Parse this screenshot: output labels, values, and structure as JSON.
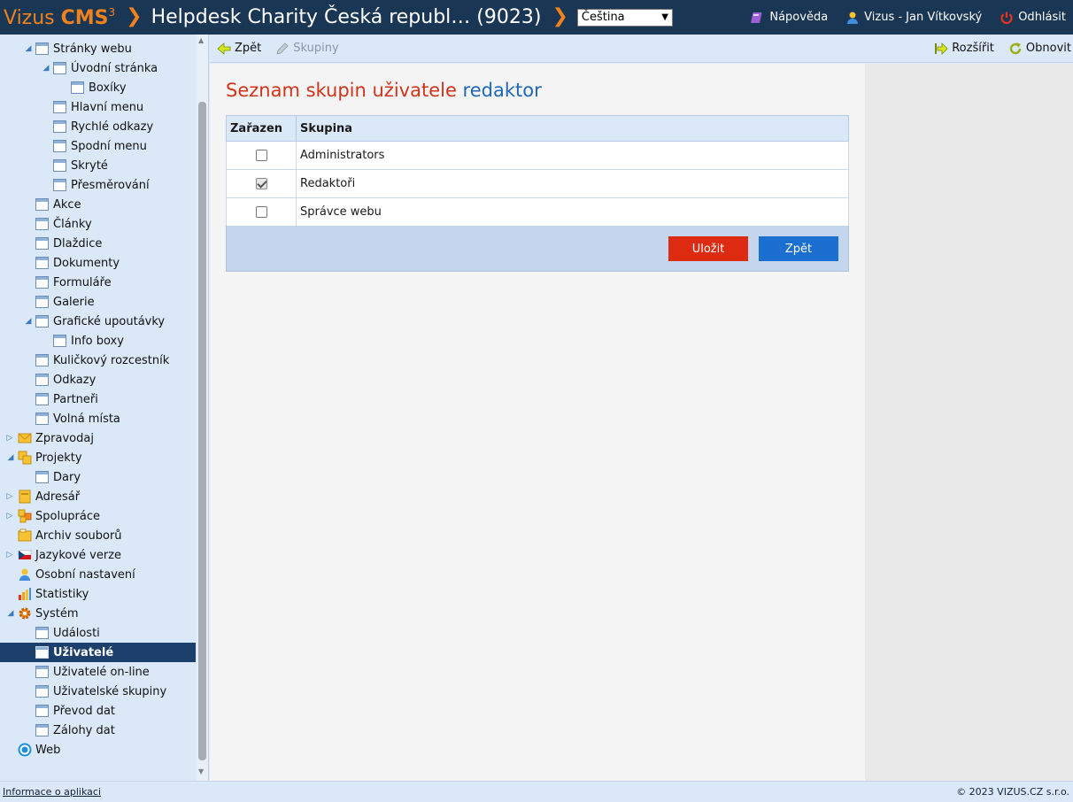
{
  "header": {
    "brand_light": "Vizus ",
    "brand_bold": "CMS",
    "brand_sup": "3",
    "site_title": "Helpdesk Charity Česká republ… (9023)",
    "language": "Čeština",
    "help_label": "Nápověda",
    "user_label": "Vizus - Jan Vítkovský",
    "logout_label": "Odhlásit"
  },
  "toolbar": {
    "back_label": "Zpět",
    "groups_label": "Skupiny",
    "expand_label": "Rozšířit",
    "refresh_label": "Obnovit"
  },
  "sidebar": {
    "items": [
      {
        "label": "Stránky webu"
      },
      {
        "label": "Úvodní stránka"
      },
      {
        "label": "Boxíky"
      },
      {
        "label": "Hlavní menu"
      },
      {
        "label": "Rychlé odkazy"
      },
      {
        "label": "Spodní menu"
      },
      {
        "label": "Skryté"
      },
      {
        "label": "Přesměrování"
      },
      {
        "label": "Akce"
      },
      {
        "label": "Články"
      },
      {
        "label": "Dlaždice"
      },
      {
        "label": "Dokumenty"
      },
      {
        "label": "Formuláře"
      },
      {
        "label": "Galerie"
      },
      {
        "label": "Grafické upoutávky"
      },
      {
        "label": "Info boxy"
      },
      {
        "label": "Kuličkový rozcestník"
      },
      {
        "label": "Odkazy"
      },
      {
        "label": "Partneři"
      },
      {
        "label": "Volná místa"
      },
      {
        "label": "Zpravodaj",
        "icon": "mail-icon"
      },
      {
        "label": "Projekty",
        "icon": "projects-icon"
      },
      {
        "label": "Dary"
      },
      {
        "label": "Adresář",
        "icon": "address-book-icon"
      },
      {
        "label": "Spolupráce",
        "icon": "collaboration-icon"
      },
      {
        "label": "Archiv souborů",
        "icon": "file-archive-icon"
      },
      {
        "label": "Jazykové verze",
        "icon": "czech-flag-icon"
      },
      {
        "label": "Osobní nastavení",
        "icon": "person-icon"
      },
      {
        "label": "Statistiky",
        "icon": "bar-chart-icon"
      },
      {
        "label": "Systém",
        "icon": "gear-icon"
      },
      {
        "label": "Události"
      },
      {
        "label": "Uživatelé",
        "selected": true
      },
      {
        "label": "Uživatelé on-line"
      },
      {
        "label": "Uživatelské skupiny"
      },
      {
        "label": "Převod dat"
      },
      {
        "label": "Zálohy dat"
      },
      {
        "label": "Web",
        "icon": "globe-icon"
      }
    ]
  },
  "main": {
    "title_prefix": "Seznam skupin uživatele ",
    "title_user": "redaktor",
    "table": {
      "columns": [
        "Zařazen",
        "Skupina"
      ],
      "rows": [
        {
          "checked": false,
          "group": "Administrators"
        },
        {
          "checked": true,
          "group": "Redaktoři"
        },
        {
          "checked": false,
          "group": "Správce webu"
        }
      ]
    },
    "save_label": "Uložit",
    "back_label": "Zpět"
  },
  "footer": {
    "info_link": "Informace o aplikaci",
    "copyright": "© 2023 VIZUS.CZ s.r.o."
  },
  "colors": {
    "header_bg": "#1a3655",
    "brand_orange": "#f0821e",
    "title_red": "#d2331a",
    "title_blue": "#1d68b8",
    "save_button": "#dd2a10",
    "back_button": "#1a6fd1",
    "selected_item": "#1c3f6b"
  }
}
